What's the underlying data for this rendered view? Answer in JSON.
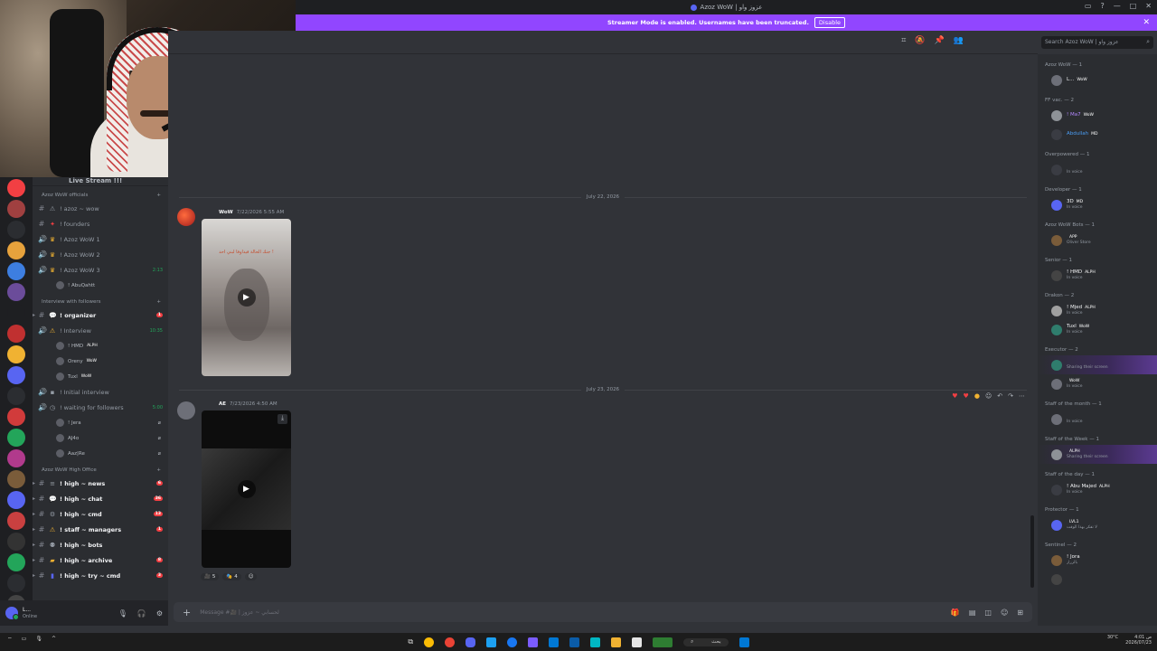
{
  "window": {
    "title": "Azoz WoW | عزوز واو",
    "controls": [
      "▭",
      "?",
      "—",
      "□",
      "✕"
    ]
  },
  "banner": {
    "text": "Streamer Mode is enabled. Usernames have been truncated.",
    "disable_label": "Disable",
    "close_label": "✕"
  },
  "channels": {
    "stream_channel": "Live Stream !!!",
    "cat1": "Azoz WoW officials",
    "cat1_list": [
      {
        "emoji": "⚠",
        "name": "! azoz ~ wow",
        "type": "text"
      },
      {
        "emoji": "★",
        "name": "! founders",
        "type": "text"
      },
      {
        "emoji": "👑",
        "name": "! Azoz WoW 1",
        "type": "voice"
      },
      {
        "emoji": "👑",
        "name": "! Azoz WoW 2",
        "type": "voice"
      },
      {
        "emoji": "👑",
        "name": "! Azoz WoW 3",
        "type": "voice",
        "time": "2:13"
      }
    ],
    "abu": "! AbuQahtt",
    "cat2": "Interview with followers",
    "organizer": "! organizer",
    "organizer_badge": "1",
    "interview": "! Interview",
    "interview_time": "10:35",
    "interview_users": [
      {
        "name": "! HMD",
        "tag": "ALPH"
      },
      {
        "name": "Oreny",
        "tag": "WoW"
      },
      {
        "name": "Tuxl",
        "tag": "WoW"
      }
    ],
    "initial": "! Initial interview",
    "waiting": "! waiting for followers",
    "waiting_time": "5:00",
    "waiting_users": [
      "! Jera",
      "AJ4o",
      "Aaz|Re"
    ],
    "cat3": "Azoz WoW High Office",
    "cat3_list": [
      {
        "emoji": "≡",
        "name": "! high ~ news",
        "badge": "6"
      },
      {
        "emoji": "💬",
        "name": "! high ~ chat",
        "badge": "36"
      },
      {
        "emoji": "⚙",
        "name": "! high ~ cmd",
        "badge": "13"
      },
      {
        "emoji": "⚠",
        "name": "! staff ~ managers",
        "badge": "1"
      },
      {
        "emoji": "🤖",
        "name": "! high ~ bots",
        "badge": ""
      },
      {
        "emoji": "📁",
        "name": "! high ~ archive",
        "badge": "8"
      },
      {
        "emoji": "📘",
        "name": "! high ~ try ~ cmd",
        "badge": "3"
      }
    ]
  },
  "userbar": {
    "name": "L...",
    "status": "Online"
  },
  "chat": {
    "search_placeholder": "Search Azoz WoW | عزوز واو",
    "date1": "July 22, 2026",
    "date2": "July 23, 2026",
    "msg1": {
      "tag": "WoW",
      "time": "7/22/2026 5:55 AM",
      "caption": "جنك الحالة فيداوفا لبني احد !"
    },
    "msg2": {
      "tag": "AE",
      "time": "7/23/2026 4:50 AM"
    },
    "reactions": [
      {
        "emoji": "🎥",
        "count": "5"
      },
      {
        "emoji": "🎭",
        "count": "4"
      }
    ],
    "composer_placeholder": "Message #🎥 | لحسابي ~ عزوز"
  },
  "members": {
    "groups": [
      {
        "title": "Azoz WoW — 1",
        "items": [
          {
            "name": "L...",
            "tag": "WoW",
            "status": ""
          }
        ]
      },
      {
        "title": "FF vac. — 2",
        "items": [
          {
            "name": "! Ma7",
            "tag": "WoW",
            "status": ""
          },
          {
            "name": "Abdullah",
            "tag": "MD",
            "status": ""
          }
        ]
      },
      {
        "title": "Overpowered — 1",
        "items": [
          {
            "name": "",
            "tag": "",
            "status": "In voice"
          }
        ]
      },
      {
        "title": "Developer — 1",
        "items": [
          {
            "name": "3D",
            "tag": "MD",
            "status": "In voice"
          }
        ]
      },
      {
        "title": "Azoz WoW Bots — 1",
        "items": [
          {
            "name": "",
            "tag": "APP",
            "status": "Oliver Store"
          }
        ]
      },
      {
        "title": "Senior — 1",
        "items": [
          {
            "name": "! HMD",
            "tag": "ALPH",
            "status": "In voice"
          }
        ]
      },
      {
        "title": "Drakon — 2",
        "items": [
          {
            "name": "! Mjed",
            "tag": "ALPH",
            "status": "In voice"
          },
          {
            "name": "Tuxl",
            "tag": "WoW",
            "status": "In voice"
          }
        ]
      },
      {
        "title": "Executor — 2",
        "items": [
          {
            "name": "",
            "tag": "",
            "status": "Sharing their screen"
          },
          {
            "name": "",
            "tag": "WoW",
            "status": "In voice"
          }
        ]
      },
      {
        "title": "Staff of the month — 1",
        "items": [
          {
            "name": "",
            "tag": "",
            "status": "In voice"
          }
        ]
      },
      {
        "title": "Staff of the Week — 1",
        "items": [
          {
            "name": "",
            "tag": "ALPH",
            "status": "Sharing their screen"
          }
        ]
      },
      {
        "title": "Staff of the day — 1",
        "items": [
          {
            "name": "! Abu Majed",
            "tag": "ALPH",
            "status": "In voice"
          }
        ]
      },
      {
        "title": "Protector — 1",
        "items": [
          {
            "name": "",
            "tag": "LVL1",
            "status": "لا تفكر بهذا الوقت"
          }
        ]
      },
      {
        "title": "Sentinel — 2",
        "items": [
          {
            "name": "! Jora",
            "tag": "",
            "status": "بالزرار"
          },
          {
            "name": "",
            "tag": "",
            "status": ""
          }
        ]
      }
    ]
  },
  "taskbar": {
    "search_label": "بحث",
    "weather": "30°C",
    "time": "4:01 ص",
    "date": "2026/07/23"
  },
  "colors": {
    "accent": "#5865f2",
    "banner": "#9146ff",
    "online": "#23a55a",
    "alert": "#f23f43"
  }
}
